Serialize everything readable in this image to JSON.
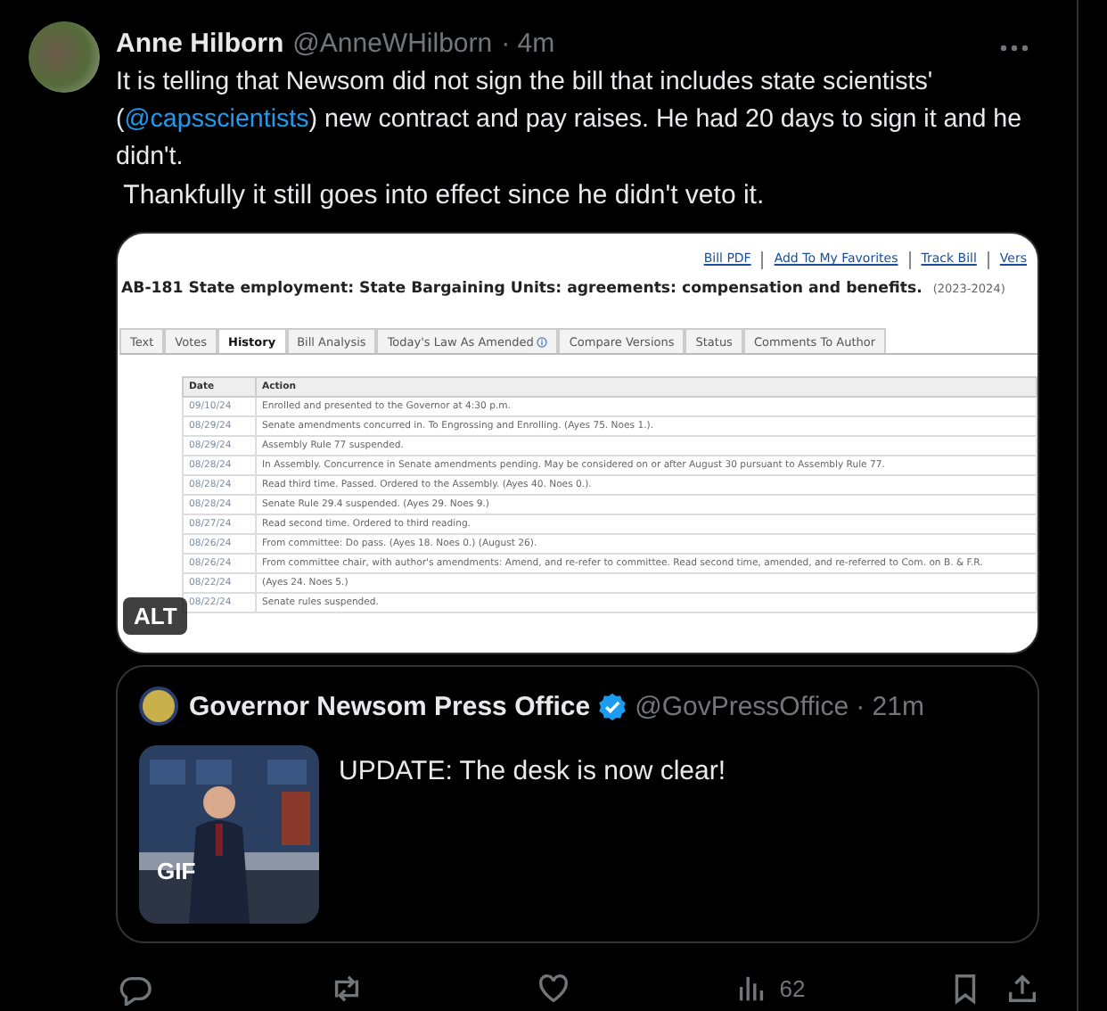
{
  "post": {
    "author": {
      "name": "Anne Hilborn",
      "handle": "@AnneWHilborn",
      "time": "· 4m"
    },
    "text": {
      "before": "It is telling that Newsom did not sign the bill that includes state scientists' (",
      "mention": "@capsscientists",
      "after": ") new contract and pay raises. He had 20 days to sign it and he didn't."
    },
    "text_2": " Thankfully it still goes into effect since he didn't veto it.",
    "media": {
      "alt_badge": "ALT",
      "screenshot": {
        "links": [
          "Bill PDF",
          "Add To My Favorites",
          "Track Bill",
          "Vers"
        ],
        "title": "AB-181 State employment: State Bargaining Units: agreements: compensation and benefits.",
        "session": "(2023-2024)",
        "tabs": [
          {
            "label": "Text",
            "selected": false
          },
          {
            "label": "Votes",
            "selected": false
          },
          {
            "label": "History",
            "selected": true
          },
          {
            "label": "Bill Analysis",
            "selected": false
          },
          {
            "label": "Today's Law As Amended",
            "selected": false,
            "info": true
          },
          {
            "label": "Compare Versions",
            "selected": false
          },
          {
            "label": "Status",
            "selected": false
          },
          {
            "label": "Comments To Author",
            "selected": false
          }
        ],
        "columns": [
          "Date",
          "Action"
        ],
        "rows": [
          [
            "09/10/24",
            "Enrolled and presented to the Governor at 4:30 p.m."
          ],
          [
            "08/29/24",
            "Senate amendments concurred in. To Engrossing and Enrolling. (Ayes 75. Noes 1.)."
          ],
          [
            "08/29/24",
            "Assembly Rule 77 suspended."
          ],
          [
            "08/28/24",
            "In Assembly. Concurrence in Senate amendments pending. May be considered on or after August 30 pursuant to Assembly Rule 77."
          ],
          [
            "08/28/24",
            "Read third time. Passed. Ordered to the Assembly. (Ayes 40. Noes 0.)."
          ],
          [
            "08/28/24",
            "Senate Rule 29.4 suspended. (Ayes 29. Noes 9.)"
          ],
          [
            "08/27/24",
            "Read second time. Ordered to third reading."
          ],
          [
            "08/26/24",
            "From committee: Do pass. (Ayes 18. Noes 0.) (August 26)."
          ],
          [
            "08/26/24",
            "From committee chair, with author's amendments: Amend, and re-refer to committee. Read second time, amended, and re-referred to Com. on B. & F.R."
          ],
          [
            "08/22/24",
            "(Ayes 24. Noes 5.)"
          ],
          [
            "08/22/24",
            "Senate rules suspended."
          ]
        ]
      }
    }
  },
  "quote": {
    "name": "Governor Newsom Press Office",
    "verified": true,
    "handle": "@GovPressOffice",
    "time": "· 21m",
    "text": "UPDATE: The desk is now clear!",
    "media": {
      "kind": "picture",
      "badge": "GIF"
    }
  },
  "actions": [
    {
      "kind": "reply"
    },
    {
      "kind": "repost"
    },
    {
      "kind": "like"
    },
    {
      "kind": "views",
      "count": "62"
    },
    {
      "kind": "bookmark"
    },
    {
      "kind": "share"
    }
  ]
}
